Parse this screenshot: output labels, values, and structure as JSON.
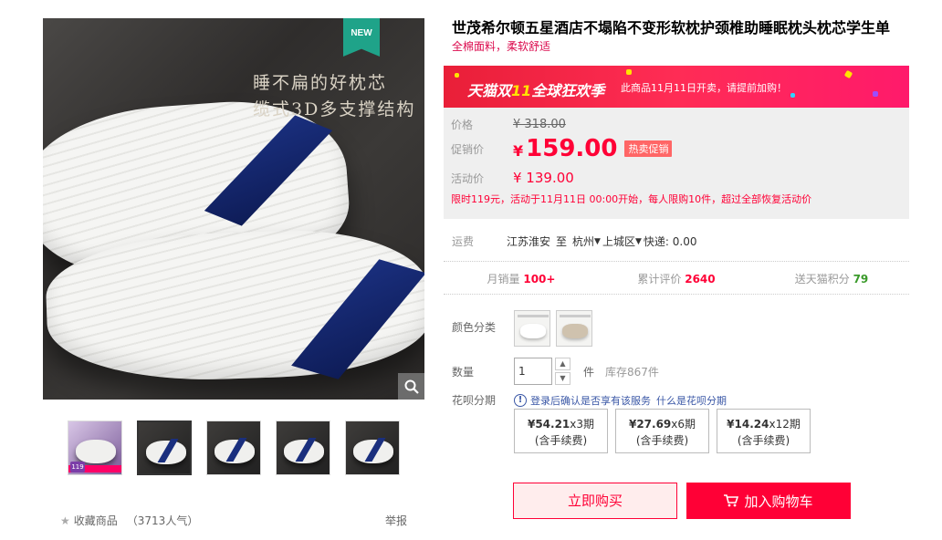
{
  "gallery": {
    "new_badge": "NEW",
    "tagline_line1": "睡不扁的好枕芯",
    "tagline_line2": "缆式3D多支撑结构",
    "zoom_icon": "search-icon",
    "thumbnails": [
      "thumb-1",
      "thumb-2",
      "thumb-3",
      "thumb-4",
      "thumb-5"
    ],
    "thumb1_badge": "119"
  },
  "favorites": {
    "label": "收藏商品",
    "count": "（3713人气）",
    "report": "举报"
  },
  "product": {
    "title": "世茂希尔顿五星酒店不塌陷不变形软枕护颈椎助睡眠枕头枕芯学生单",
    "subtitle": "全棉面料，柔软舒适"
  },
  "promo_banner": {
    "logo_part1": "天猫双",
    "logo_part2": "11",
    "logo_part3": "全球狂欢季",
    "message": "此商品11月11日开卖，请提前加购！"
  },
  "pricing": {
    "price_label": "价格",
    "original_price": "¥ 318.00",
    "promo_label": "促销价",
    "currency": "¥",
    "promo_price": "159.00",
    "hot_tag": "热卖促销",
    "event_label": "活动价",
    "event_price": "¥ 139.00",
    "event_note": "限时119元，活动于11月11日 00:00开始，每人限购10件，超过全部恢复活动价"
  },
  "shipping": {
    "label": "运费",
    "origin": "江苏淮安",
    "to": "至",
    "city": "杭州",
    "district": "上城区",
    "express": "快递: 0.00"
  },
  "stats": {
    "monthly_sales_label": "月销量",
    "monthly_sales_value": "100+",
    "reviews_label": "累计评价",
    "reviews_value": "2640",
    "points_label": "送天猫积分",
    "points_value": "79"
  },
  "options": {
    "color_label": "颜色分类",
    "quantity_label": "数量",
    "quantity_value": "1",
    "unit": "件",
    "stock": "库存867件",
    "installment_label": "花呗分期",
    "installment_notice": "登录后确认是否享有该服务",
    "installment_link": "什么是花呗分期",
    "plans": [
      {
        "amount": "¥54.21",
        "term": "x3期",
        "fee": "(含手续费)"
      },
      {
        "amount": "¥27.69",
        "term": "x6期",
        "fee": "(含手续费)"
      },
      {
        "amount": "¥14.24",
        "term": "x12期",
        "fee": "(含手续费)"
      }
    ]
  },
  "actions": {
    "buy_now": "立即购买",
    "add_to_cart": "加入购物车"
  },
  "colors": {
    "accent": "#ff0036",
    "brand_red": "#db0a4d",
    "link_blue": "#3a57a6",
    "badge_green": "#1fa389"
  }
}
